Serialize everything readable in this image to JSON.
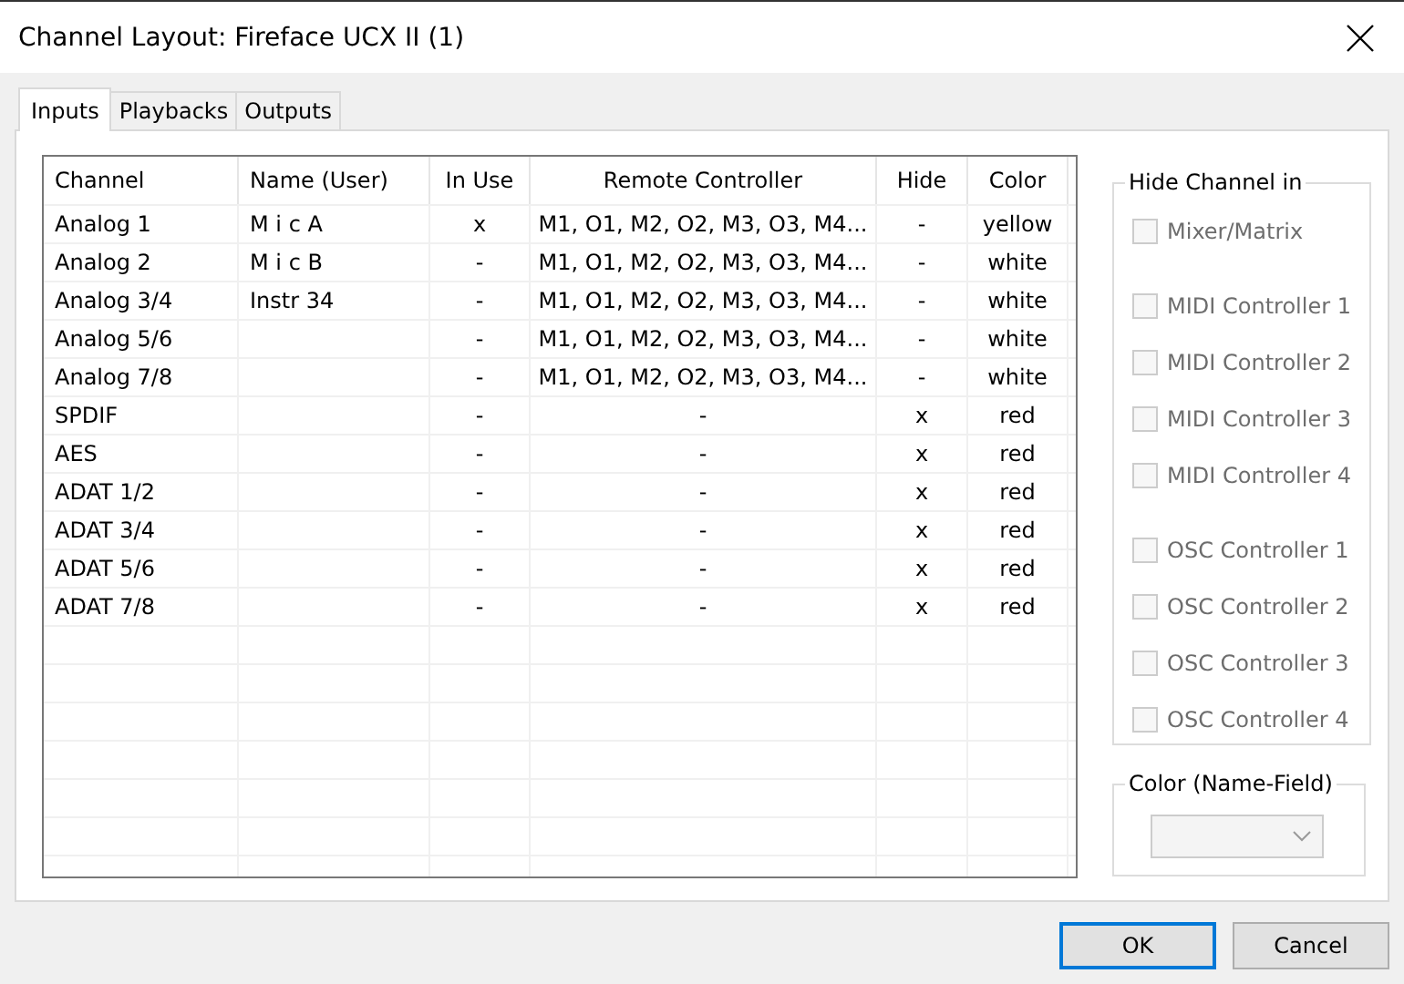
{
  "window": {
    "title": "Channel Layout: Fireface UCX II (1)"
  },
  "tabs": [
    {
      "label": "Inputs",
      "selected": true
    },
    {
      "label": "Playbacks",
      "selected": false
    },
    {
      "label": "Outputs",
      "selected": false
    }
  ],
  "table": {
    "columns": [
      "Channel",
      "Name (User)",
      "In Use",
      "Remote Controller",
      "Hide",
      "Color"
    ],
    "rows": [
      [
        "Analog 1",
        "M i c A",
        "x",
        "M1, O1, M2, O2, M3, O3, M4...",
        "-",
        "yellow"
      ],
      [
        "Analog 2",
        "M i c B",
        "-",
        "M1, O1, M2, O2, M3, O3, M4...",
        "-",
        "white"
      ],
      [
        "Analog 3/4",
        "Instr 34",
        "-",
        "M1, O1, M2, O2, M3, O3, M4...",
        "-",
        "white"
      ],
      [
        "Analog 5/6",
        "",
        "-",
        "M1, O1, M2, O2, M3, O3, M4...",
        "-",
        "white"
      ],
      [
        "Analog 7/8",
        "",
        "-",
        "M1, O1, M2, O2, M3, O3, M4...",
        "-",
        "white"
      ],
      [
        "SPDIF",
        "",
        "-",
        "-",
        "x",
        "red"
      ],
      [
        "AES",
        "",
        "-",
        "-",
        "x",
        "red"
      ],
      [
        "ADAT 1/2",
        "",
        "-",
        "-",
        "x",
        "red"
      ],
      [
        "ADAT 3/4",
        "",
        "-",
        "-",
        "x",
        "red"
      ],
      [
        "ADAT 5/6",
        "",
        "-",
        "-",
        "x",
        "red"
      ],
      [
        "ADAT 7/8",
        "",
        "-",
        "-",
        "x",
        "red"
      ]
    ]
  },
  "hide_channel_in": {
    "title": "Hide Channel in",
    "groups": [
      [
        {
          "label": "Mixer/Matrix",
          "checked": false,
          "disabled": true
        }
      ],
      [
        {
          "label": "MIDI Controller 1",
          "checked": false,
          "disabled": true
        },
        {
          "label": "MIDI Controller 2",
          "checked": false,
          "disabled": true
        },
        {
          "label": "MIDI Controller 3",
          "checked": false,
          "disabled": true
        },
        {
          "label": "MIDI Controller 4",
          "checked": false,
          "disabled": true
        }
      ],
      [
        {
          "label": "OSC Controller 1",
          "checked": false,
          "disabled": true
        },
        {
          "label": "OSC Controller 2",
          "checked": false,
          "disabled": true
        },
        {
          "label": "OSC Controller 3",
          "checked": false,
          "disabled": true
        },
        {
          "label": "OSC Controller 4",
          "checked": false,
          "disabled": true
        }
      ]
    ]
  },
  "color_group": {
    "title": "Color (Name-Field)",
    "dropdown": {
      "disabled": true
    }
  },
  "buttons": [
    {
      "label": "OK",
      "default": true
    },
    {
      "label": "Cancel",
      "default": false
    }
  ]
}
